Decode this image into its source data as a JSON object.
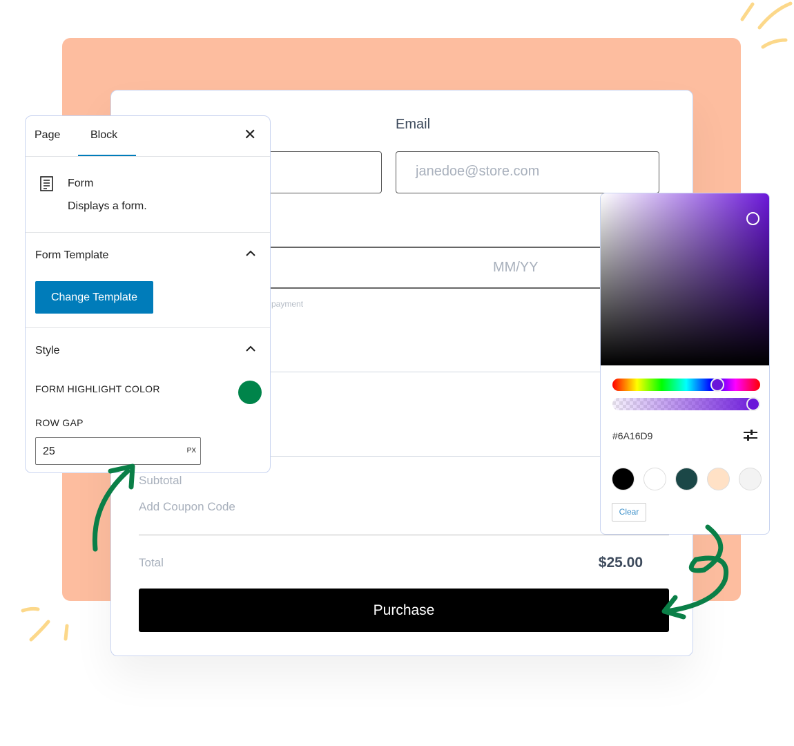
{
  "form": {
    "email_label": "Email",
    "email_placeholder": "janedoe@store.com",
    "expiry_placeholder": "MM/YY",
    "payment_note": "payment",
    "subtotal_label": "Subtotal",
    "coupon_link": "Add Coupon Code",
    "total_label": "Total",
    "total_value": "$25.00",
    "purchase_label": "Purchase"
  },
  "panel": {
    "tabs": [
      {
        "label": "Page",
        "active": false
      },
      {
        "label": "Block",
        "active": true
      }
    ],
    "block_title": "Form",
    "block_desc": "Displays a form.",
    "template_section": "Form Template",
    "change_template": "Change Template",
    "style_section": "Style",
    "highlight_label": "FORM HIGHLIGHT COLOR",
    "highlight_color": "#00844a",
    "row_gap_label": "ROW GAP",
    "row_gap_value": "25",
    "row_gap_unit": "PX"
  },
  "picker": {
    "hex": "#6A16D9",
    "hue_fraction": 0.73,
    "alpha_fraction": 1.0,
    "swatches": [
      "#000000",
      "#ffffff",
      "#1b4747",
      "#ffe1c6",
      "#f3f3f3"
    ],
    "clear_label": "Clear"
  },
  "colors": {
    "accent": "#007cba",
    "background_peach": "#fdbd9f",
    "arrow_green": "#0a7f47"
  }
}
